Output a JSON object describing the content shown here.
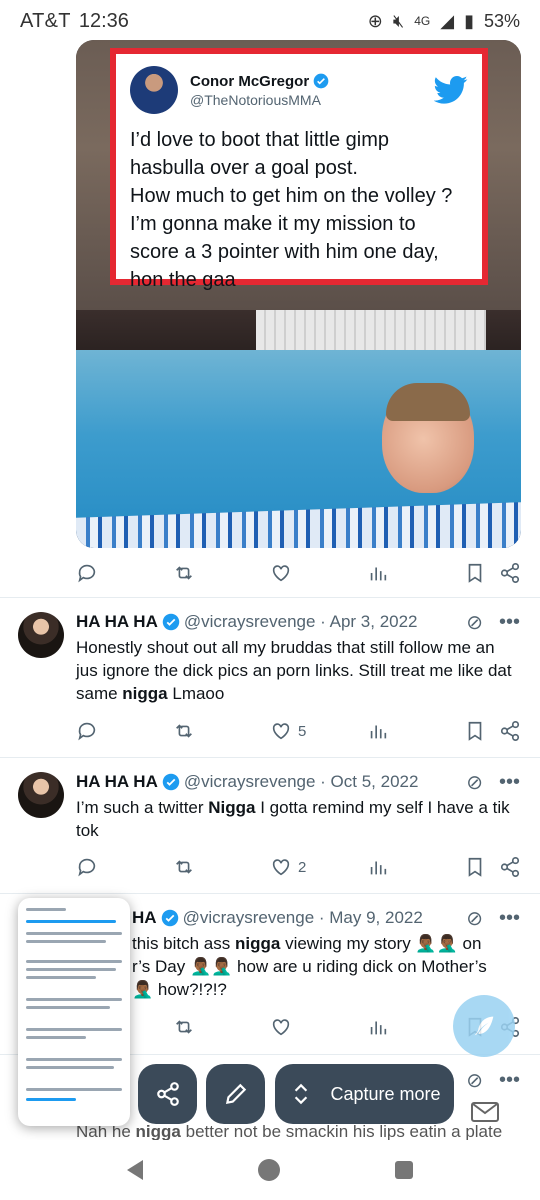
{
  "status_bar": {
    "carrier": "AT&T",
    "time": "12:36",
    "network": "4G",
    "battery": "53%"
  },
  "top_tweet": {
    "quote": {
      "name": "Conor McGregor",
      "handle": "@TheNotoriousMMA",
      "text": "I’d love to boot that little gimp\nhasbulla over a goal post.\nHow much to get him on the volley ?\nI’m gonna make it my mission to\nscore a 3 pointer with him one day,\nhon the gaa"
    }
  },
  "tweets": [
    {
      "name": "HA HA HA",
      "handle_date": "@vicraysrevenge · Apr 3, 2022",
      "text_parts": [
        "Honestly shout out all my bruddas that still follow me an jus ignore the dick pics an porn links. Still treat me like dat same ",
        "nigga",
        " Lmaoo"
      ],
      "likes": "5"
    },
    {
      "name": "HA HA HA",
      "handle_date": "@vicraysrevenge · Oct 5, 2022",
      "text_parts": [
        "I’m such a twitter ",
        "Nigga",
        " I gotta remind my self I have a tik tok"
      ],
      "likes": "2"
    },
    {
      "name": "HA",
      "handle_date": "@vicraysrevenge · May 9, 2022",
      "text_line1_parts": [
        "this bitch ass ",
        "nigga",
        " viewing my story 🤦🏾‍♂️🤦🏾‍♂️ on"
      ],
      "text_line2": "r’s Day 🤦🏾‍♂️🤦🏾‍♂️ how are u riding dick on Mother’s",
      "text_line3": "🤦🏾‍♂️ how?!?!?"
    }
  ],
  "bottom_partial_parts": [
    "Nah he ",
    "nigga",
    " better not be smackin his lips eatin a plate"
  ],
  "capture_toolbar": {
    "capture_more_label": "Capture more"
  }
}
